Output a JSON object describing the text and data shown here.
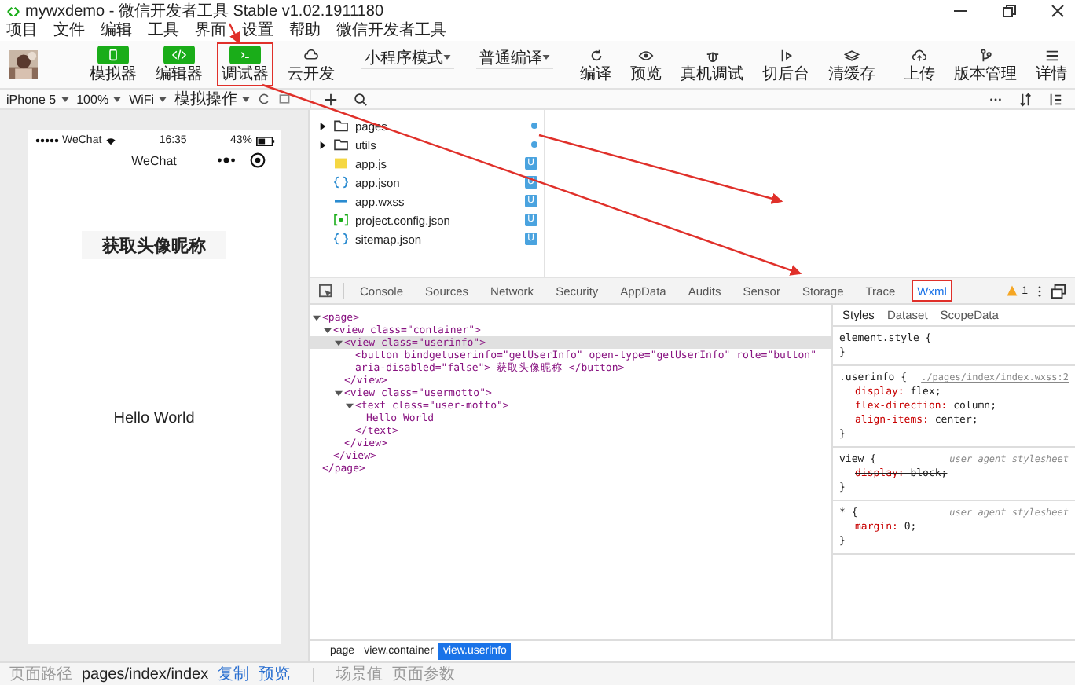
{
  "window": {
    "title": "mywxdemo - 微信开发者工具 Stable v1.02.1911180"
  },
  "menu": [
    "项目",
    "文件",
    "编辑",
    "工具",
    "界面",
    "设置",
    "帮助",
    "微信开发者工具"
  ],
  "mode_buttons": [
    {
      "label": "模拟器",
      "kind": "phone",
      "on": true,
      "highlighted": false
    },
    {
      "label": "编辑器",
      "kind": "code",
      "on": true,
      "highlighted": false
    },
    {
      "label": "调试器",
      "kind": "debug",
      "on": true,
      "highlighted": true
    },
    {
      "label": "云开发",
      "kind": "cloud",
      "on": false,
      "highlighted": false
    }
  ],
  "mode_select": {
    "value": "小程序模式"
  },
  "compile_select": {
    "value": "普通编译"
  },
  "actions": [
    {
      "label": "编译",
      "kind": "refresh"
    },
    {
      "label": "预览",
      "kind": "eye"
    },
    {
      "label": "真机调试",
      "kind": "bug"
    },
    {
      "label": "切后台",
      "kind": "switch"
    },
    {
      "label": "清缓存",
      "kind": "layers"
    }
  ],
  "right_actions": [
    {
      "label": "上传",
      "kind": "upload"
    },
    {
      "label": "版本管理",
      "kind": "branch"
    },
    {
      "label": "详情",
      "kind": "list"
    }
  ],
  "simulator_bar": [
    {
      "value": "iPhone 5"
    },
    {
      "value": "100%"
    },
    {
      "value": "WiFi"
    },
    {
      "value": "模拟操作"
    }
  ],
  "phone": {
    "carrier": "WeChat",
    "time": "16:35",
    "battery": "43%",
    "nav_title": "WeChat",
    "button": "获取头像昵称",
    "motto": "Hello World"
  },
  "files": [
    {
      "name": "pages",
      "kind": "folder",
      "expanded": false
    },
    {
      "name": "utils",
      "kind": "folder",
      "expanded": false
    },
    {
      "name": "app.js",
      "kind": "js",
      "badge": "U"
    },
    {
      "name": "app.json",
      "kind": "json",
      "badge": "U"
    },
    {
      "name": "app.wxss",
      "kind": "wxss",
      "badge": "U"
    },
    {
      "name": "project.config.json",
      "kind": "config",
      "badge": "U"
    },
    {
      "name": "sitemap.json",
      "kind": "json",
      "badge": "U"
    }
  ],
  "devtools_tabs": [
    {
      "label": "Console",
      "selected": false,
      "highlighted": false
    },
    {
      "label": "Sources",
      "selected": false,
      "highlighted": false
    },
    {
      "label": "Network",
      "selected": false,
      "highlighted": false
    },
    {
      "label": "Security",
      "selected": false,
      "highlighted": false
    },
    {
      "label": "AppData",
      "selected": false,
      "highlighted": false
    },
    {
      "label": "Audits",
      "selected": false,
      "highlighted": false
    },
    {
      "label": "Sensor",
      "selected": false,
      "highlighted": false
    },
    {
      "label": "Storage",
      "selected": false,
      "highlighted": false
    },
    {
      "label": "Trace",
      "selected": false,
      "highlighted": false
    },
    {
      "label": "Wxml",
      "selected": true,
      "highlighted": true
    }
  ],
  "warning_count": "1",
  "wxml": [
    {
      "text": "<page>",
      "close": "</page>",
      "expanded": true,
      "selected": false,
      "children": [
        {
          "text": "<view class=\"container\">",
          "close": "</view>",
          "expanded": true,
          "selected": false,
          "children": [
            {
              "text": "<view class=\"userinfo\">",
              "close": "</view>",
              "expanded": true,
              "selected": true,
              "children": [
                {
                  "text": "<button bindgetuserinfo=\"getUserInfo\" open-type=\"getUserInfo\" role=\"button\" aria-disabled=\"false\"> 获取头像昵称 </button>",
                  "selected": false
                }
              ]
            },
            {
              "text": "<view class=\"usermotto\">",
              "close": "</view>",
              "expanded": true,
              "selected": false,
              "children": [
                {
                  "text": "<text class=\"user-motto\">",
                  "close": "</text>",
                  "expanded": true,
                  "selected": false,
                  "children": [
                    {
                      "text": "Hello World",
                      "selected": false
                    }
                  ]
                }
              ]
            }
          ]
        }
      ]
    }
  ],
  "style_tabs": [
    {
      "label": "Styles",
      "selected": true
    },
    {
      "label": "Dataset",
      "selected": false
    },
    {
      "label": "ScopeData",
      "selected": false
    }
  ],
  "style_rules": [
    {
      "selector": "element.style {"
    },
    {
      "selector": ".userinfo {",
      "source": "./pages/index/index.wxss:2",
      "props": [
        {
          "name": "display:",
          "value": "flex;",
          "struck": false
        },
        {
          "name": "flex-direction:",
          "value": "column;",
          "struck": false
        },
        {
          "name": "align-items:",
          "value": "center;",
          "struck": false
        }
      ]
    },
    {
      "selector": "view {",
      "source": "user agent stylesheet",
      "props": [
        {
          "name": "display:",
          "value": "block;",
          "struck": true
        }
      ]
    },
    {
      "selector": "* {",
      "source": "user agent stylesheet",
      "props": [
        {
          "name": "margin:",
          "value": "0;",
          "struck": false
        }
      ]
    }
  ],
  "rule_close": "}",
  "breadcrumb": [
    {
      "label": "page",
      "selected": false
    },
    {
      "label": "view.container",
      "selected": false
    },
    {
      "label": "view.userinfo",
      "selected": true
    }
  ],
  "status_bar": {
    "path_label": "页面路径",
    "path": "pages/index/index",
    "links": [
      "复制",
      "预览"
    ],
    "items": [
      "场景值",
      "页面参数"
    ]
  }
}
